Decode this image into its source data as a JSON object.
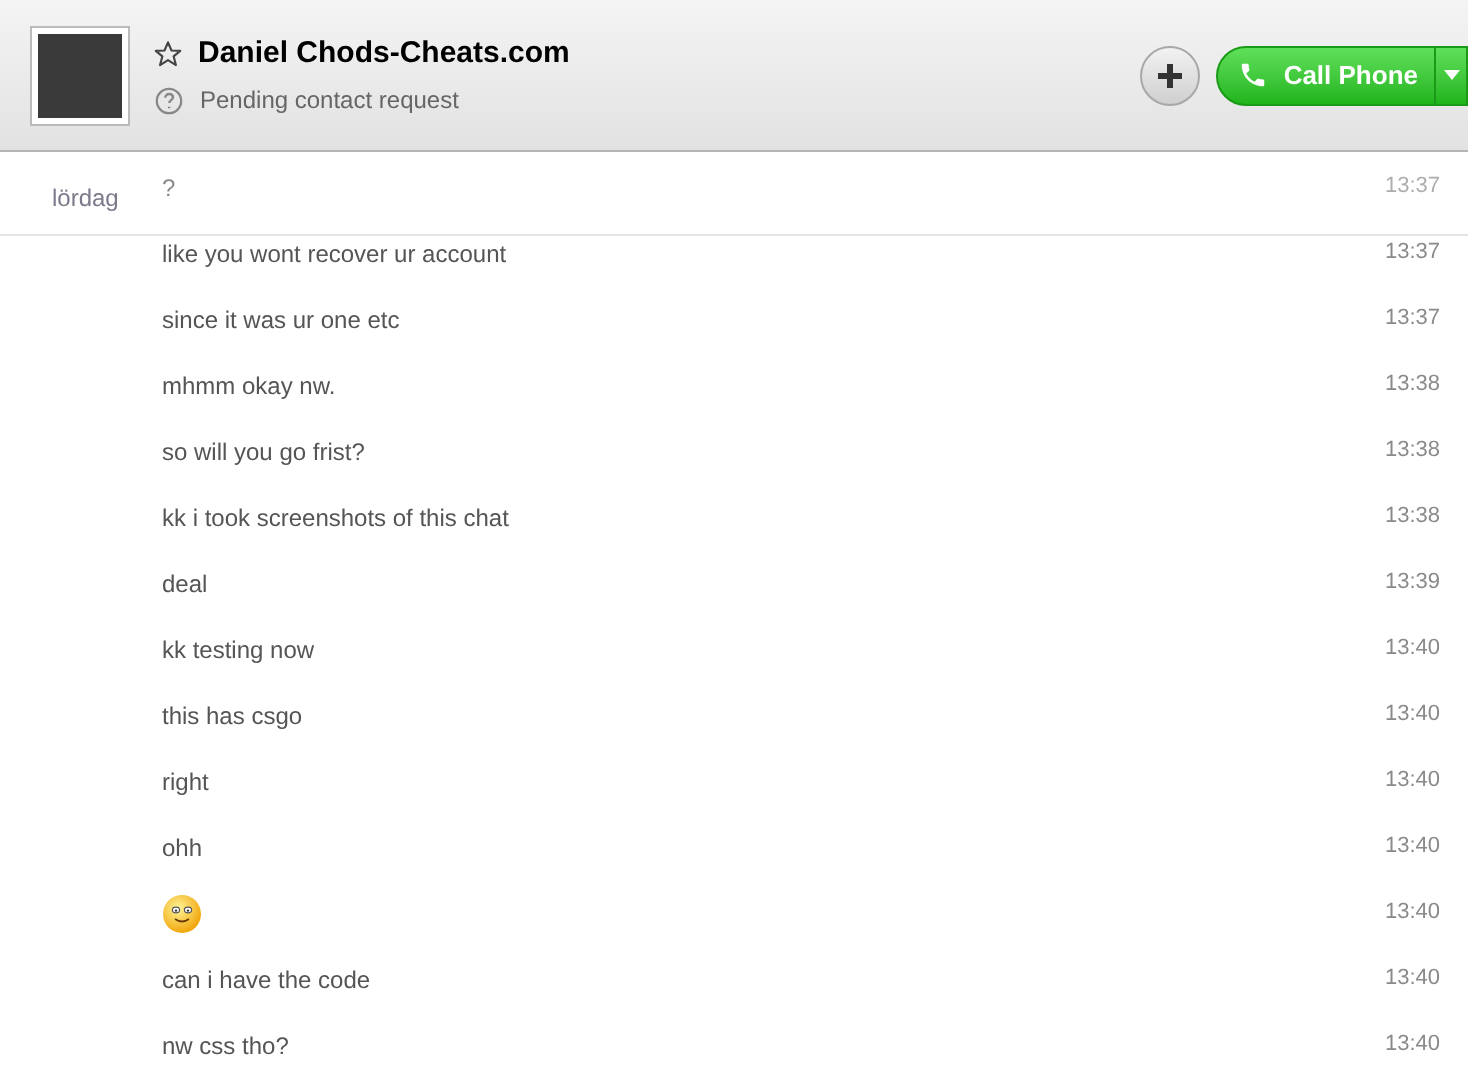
{
  "contact": {
    "name": "Daniel Chods-Cheats.com",
    "status": "Pending contact request",
    "favorite": false
  },
  "actions": {
    "call_label": "Call Phone"
  },
  "date_divider": "lördag",
  "messages": [
    {
      "kind": "text",
      "text": "?",
      "time": "13:37"
    },
    {
      "kind": "text",
      "text": "like you wont recover ur account",
      "time": "13:37"
    },
    {
      "kind": "text",
      "text": "since it was ur one etc",
      "time": "13:37"
    },
    {
      "kind": "text",
      "text": "mhmm okay nw.",
      "time": "13:38"
    },
    {
      "kind": "text",
      "text": "so will you go frist?",
      "time": "13:38"
    },
    {
      "kind": "text",
      "text": "kk i took screenshots of this chat",
      "time": "13:38"
    },
    {
      "kind": "text",
      "text": "deal",
      "time": "13:39"
    },
    {
      "kind": "text",
      "text": "kk testing now",
      "time": "13:40"
    },
    {
      "kind": "text",
      "text": "this has csgo",
      "time": "13:40"
    },
    {
      "kind": "text",
      "text": "right",
      "time": "13:40"
    },
    {
      "kind": "text",
      "text": "ohh",
      "time": "13:40"
    },
    {
      "kind": "emoticon",
      "time": "13:40"
    },
    {
      "kind": "text",
      "text": "can i have the code",
      "time": "13:40"
    },
    {
      "kind": "text",
      "text": "nw css tho?",
      "time": "13:40"
    }
  ]
}
